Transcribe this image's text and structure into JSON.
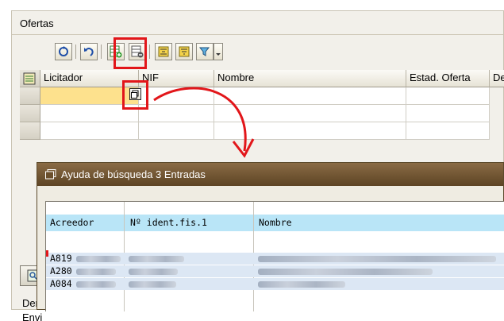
{
  "panel": {
    "title": "Ofertas"
  },
  "toolbar": {
    "buttons": [
      {
        "icon": "refresh-icon"
      },
      {
        "icon": "undo-icon"
      },
      {
        "icon": "insert-row-icon"
      },
      {
        "icon": "delete-row-icon"
      },
      {
        "icon": "align-icon"
      },
      {
        "icon": "sort-icon"
      },
      {
        "icon": "filter-icon"
      }
    ]
  },
  "table": {
    "columns": [
      "Licitador",
      "NIF",
      "Nombre",
      "Estad. Oferta",
      "De"
    ],
    "rows": [
      {
        "licitador": "",
        "nif": "",
        "nombre": "",
        "estado": ""
      },
      {
        "licitador": "",
        "nif": "",
        "nombre": "",
        "estado": ""
      },
      {
        "licitador": "",
        "nif": "",
        "nombre": "",
        "estado": ""
      }
    ]
  },
  "popup": {
    "title": "Ayuda de búsqueda 3 Entradas",
    "columns": [
      "Acreedor",
      "Nº ident.fis.1",
      "Nombre"
    ],
    "rows": [
      {
        "acreedor": "A819"
      },
      {
        "acreedor": "A280"
      },
      {
        "acreedor": "A084"
      }
    ]
  },
  "background": {
    "label_1": "Deno",
    "label_2": "Envi"
  },
  "colors": {
    "annotation": "#e2161a",
    "highlight_cell": "#fde18d",
    "popup_title_bar": "#6b4f2c",
    "list_header": "#b9e5f7"
  }
}
